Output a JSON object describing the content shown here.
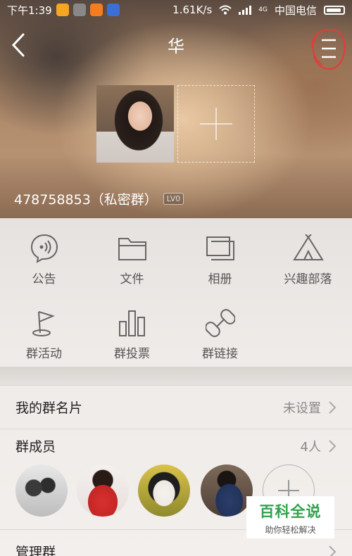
{
  "status_bar": {
    "time": "下午1:39",
    "network_speed": "1.61K/s",
    "network_type": "4G",
    "carrier": "中国电信"
  },
  "nav": {
    "title": "华"
  },
  "group": {
    "id_text": "478758853（私密群）",
    "level": "LV0"
  },
  "grid": {
    "items": [
      {
        "label": "公告",
        "icon": "announcement-icon"
      },
      {
        "label": "文件",
        "icon": "folder-icon"
      },
      {
        "label": "相册",
        "icon": "album-icon"
      },
      {
        "label": "兴趣部落",
        "icon": "tent-icon"
      },
      {
        "label": "群活动",
        "icon": "flag-icon"
      },
      {
        "label": "群投票",
        "icon": "bar-chart-icon"
      },
      {
        "label": "群链接",
        "icon": "link-icon"
      }
    ]
  },
  "rows": {
    "card": {
      "label": "我的群名片",
      "value": "未设置"
    },
    "members": {
      "label": "群成员",
      "value": "4人"
    },
    "manage": {
      "label": "管理群"
    }
  },
  "watermark": {
    "title": "百科全说",
    "subtitle": "助你轻松解决"
  },
  "colors": {
    "watermark_green": "#2fa24c",
    "annotation_red": "#e63a3a"
  }
}
